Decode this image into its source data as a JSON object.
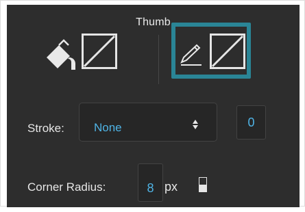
{
  "panel": {
    "title": "Thumb"
  },
  "icons": {
    "fill": "paint-bucket-icon",
    "fill_swatch": "no-color-swatch-icon",
    "stroke": "pencil-icon",
    "stroke_swatch": "no-color-swatch-icon",
    "dropdown_arrows": "updown-arrows-icon",
    "stepper": "stepper-icon"
  },
  "stroke": {
    "label": "Stroke:",
    "style_value": "None",
    "width_value": "0"
  },
  "corner_radius": {
    "label": "Corner Radius:",
    "value": "8",
    "unit": "px"
  },
  "colors": {
    "panel_bg": "#2d2d2d",
    "highlight": "#2a8596",
    "accent_text": "#4fb4e6"
  }
}
